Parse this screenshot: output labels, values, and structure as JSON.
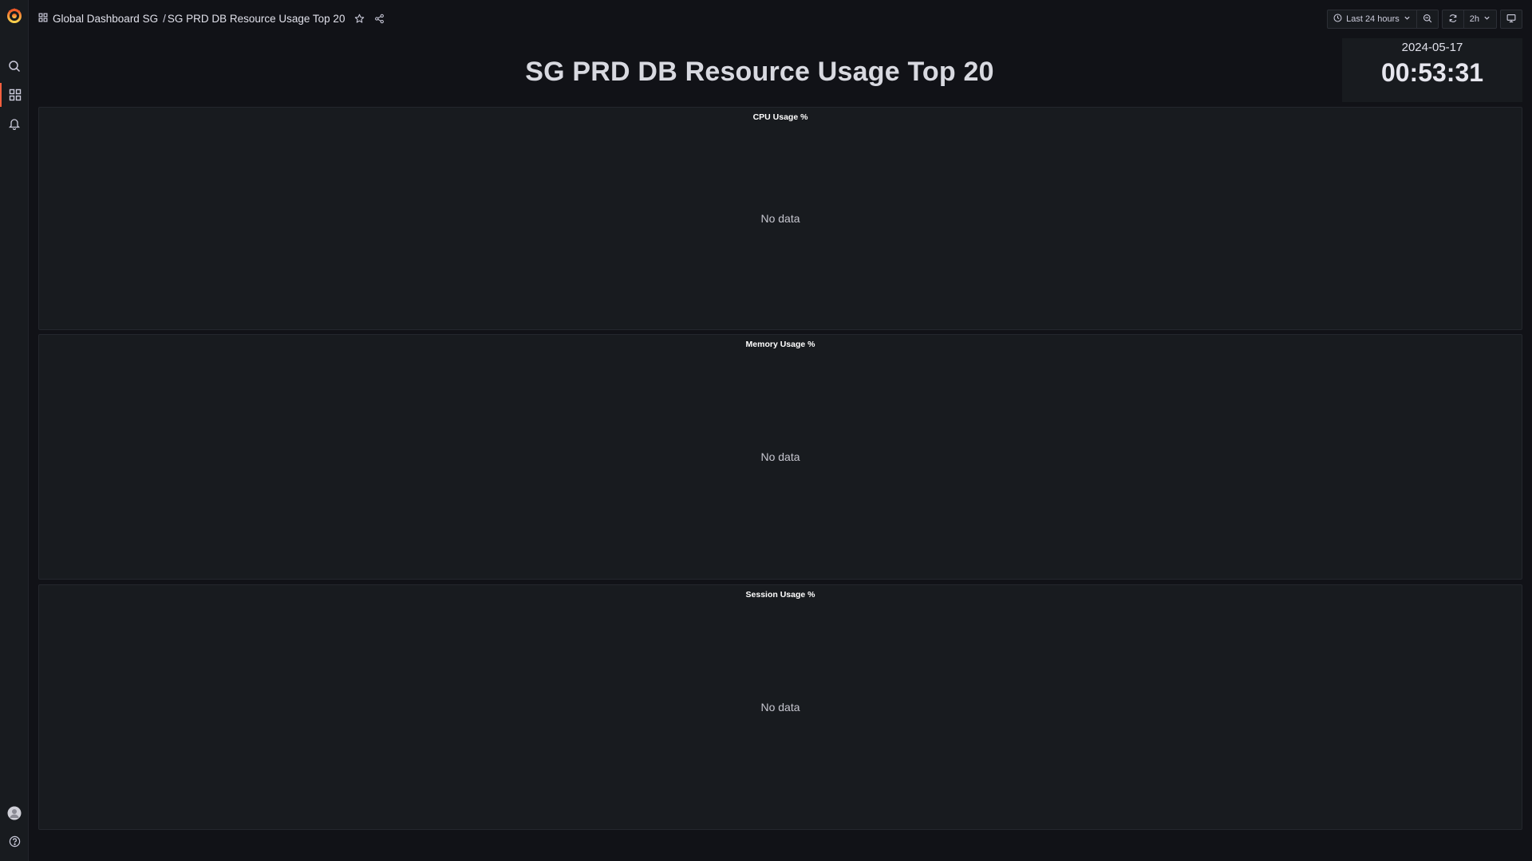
{
  "breadcrumb": {
    "folder": "Global Dashboard SG",
    "separator": "/",
    "dashboard": "SG PRD DB Resource Usage Top 20"
  },
  "toolbar": {
    "time_range": "Last 24 hours",
    "refresh_interval": "2h"
  },
  "title_panel": {
    "text": "SG PRD DB Resource Usage Top 20"
  },
  "clock": {
    "date": "2024-05-17",
    "time": "00:53:31"
  },
  "panels": [
    {
      "title": "CPU Usage %",
      "message": "No data"
    },
    {
      "title": "Memory Usage %",
      "message": "No data"
    },
    {
      "title": "Session Usage %",
      "message": "No data"
    }
  ],
  "colors": {
    "background": "#111217",
    "panel": "#181b1f",
    "accent": "#f55f3e"
  },
  "icons": {
    "logo": "grafana-logo",
    "search": "search-icon",
    "dashboards": "dashboards-grid-icon",
    "alerting": "bell-icon",
    "profile": "avatar",
    "help": "help-icon"
  }
}
